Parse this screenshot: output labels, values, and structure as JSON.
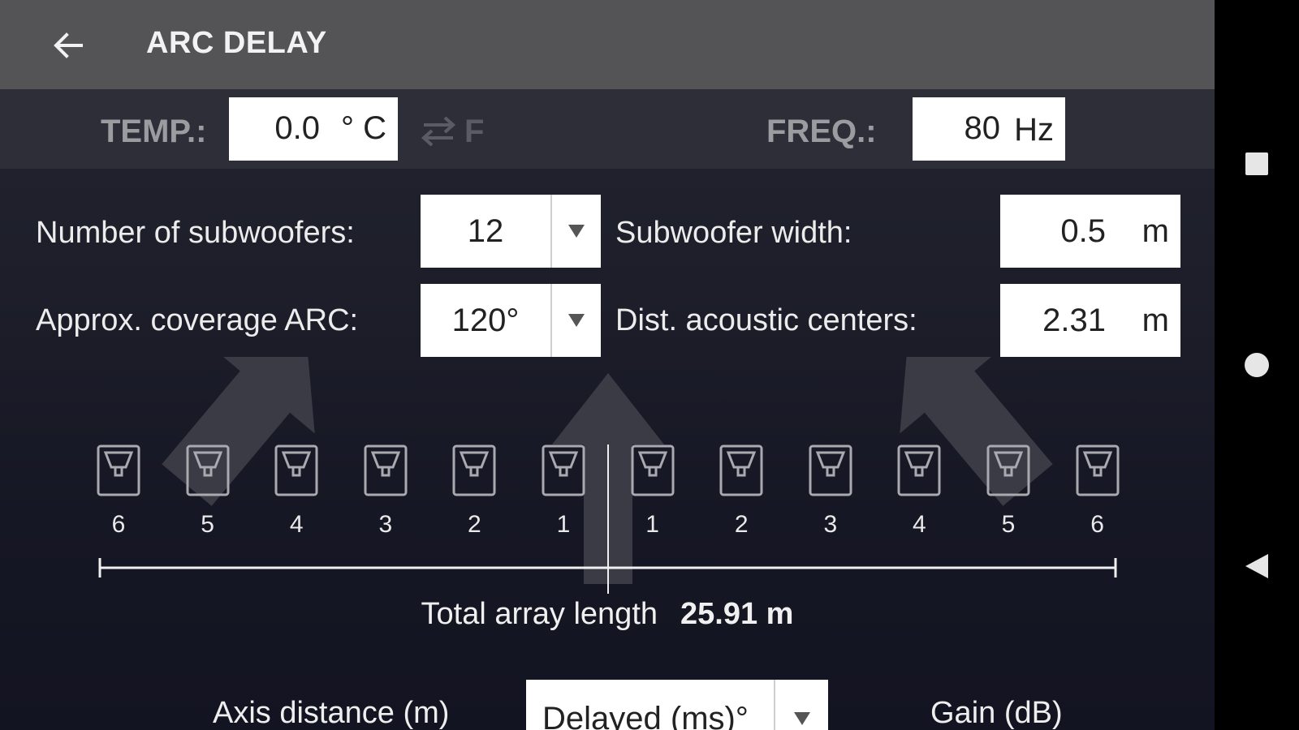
{
  "header": {
    "title": "ARC DELAY",
    "back_icon": "arrow-left-icon"
  },
  "environment": {
    "temp_label": "TEMP.:",
    "temp_value": "0.0",
    "temp_unit": "° C",
    "swap_icon": "swap-arrows-icon",
    "alt_unit": "F",
    "freq_label": "FREQ.:",
    "freq_value": "80",
    "freq_unit": "Hz"
  },
  "settings": {
    "num_subs_label": "Number of subwoofers:",
    "num_subs_value": "12",
    "coverage_label": "Approx. coverage ARC:",
    "coverage_value": "120°",
    "sub_width_label": "Subwoofer width:",
    "sub_width_value": "0.5",
    "sub_width_unit": "m",
    "dist_label": "Dist. acoustic centers:",
    "dist_value": "2.31",
    "dist_unit": "m"
  },
  "diagram": {
    "subwoofer_numbers": [
      "6",
      "5",
      "4",
      "3",
      "2",
      "1",
      "1",
      "2",
      "3",
      "4",
      "5",
      "6"
    ],
    "total_label": "Total array length",
    "total_value": "25.91 m"
  },
  "table_header": {
    "axis_label": "Axis distance (m)",
    "mode_value": "Delayed (ms)°",
    "gain_label": "Gain (dB)"
  },
  "navbar": {
    "icons": [
      "square-icon",
      "circle-icon",
      "triangle-back-icon"
    ]
  },
  "colors": {
    "topbar": "#545456",
    "envbar": "#2d2e38",
    "background": "#1d1e2a",
    "field": "#ffffff"
  }
}
